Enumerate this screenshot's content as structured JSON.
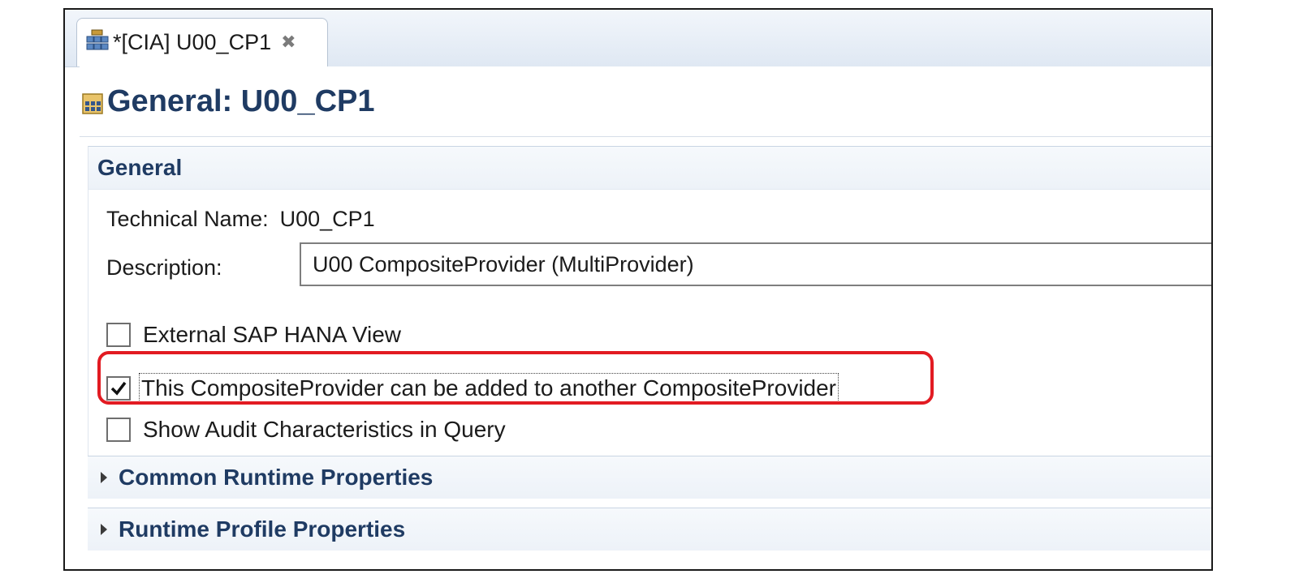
{
  "tab": {
    "label": "*[CIA] U00_CP1",
    "icon": "composite-provider-icon",
    "close_icon": "close-icon"
  },
  "header": {
    "title": "General: U00_CP1",
    "icon": "composite-provider-icon"
  },
  "general": {
    "title": "General",
    "technical_name_label": "Technical Name:",
    "technical_name_value": "U00_CP1",
    "description_label": "Description:",
    "description_value": "U00 CompositeProvider (MultiProvider)",
    "checkboxes": [
      {
        "label": "External SAP HANA View",
        "checked": false
      },
      {
        "label": "This CompositeProvider can be added to another CompositeProvider",
        "checked": true
      },
      {
        "label": "Show Audit Characteristics in Query",
        "checked": false
      }
    ]
  },
  "sections": [
    {
      "label": "Common Runtime Properties",
      "expanded": false
    },
    {
      "label": "Runtime Profile Properties",
      "expanded": false
    }
  ],
  "colors": {
    "heading": "#1f3b63",
    "highlight": "#e21b22"
  }
}
